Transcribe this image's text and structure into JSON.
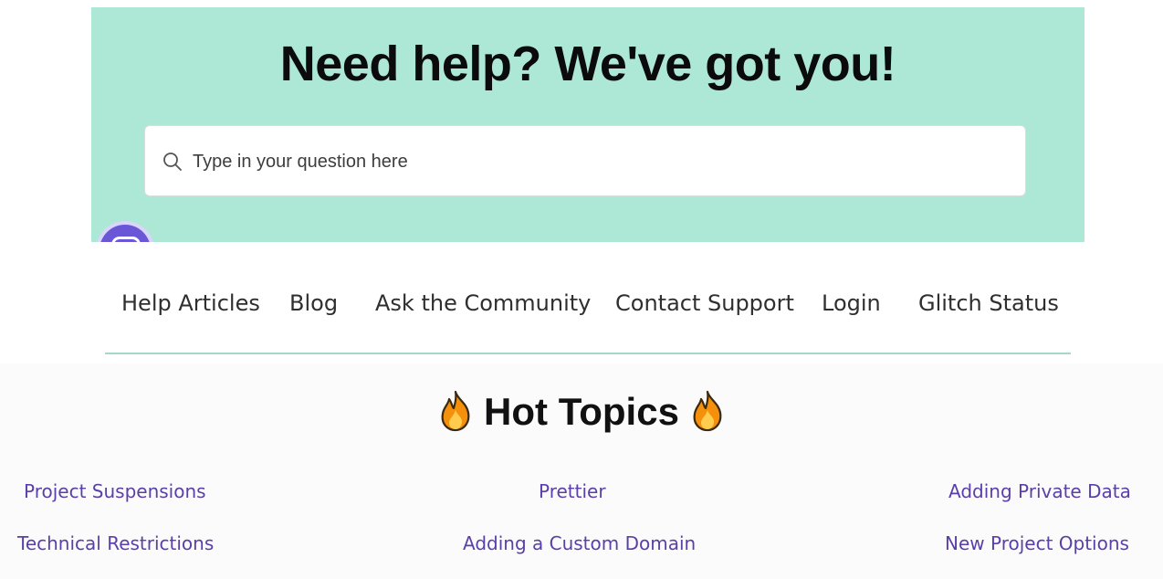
{
  "hero": {
    "title": "Need help? We've got you!",
    "background_color": "#ade8d6"
  },
  "search": {
    "placeholder": "Type in your question here",
    "value": "",
    "icon": "search-icon"
  },
  "chat_widget": {
    "icon": "chat-bubble-icon",
    "color": "#6a57d8"
  },
  "nav": {
    "items": [
      {
        "label": "Help Articles"
      },
      {
        "label": "Blog"
      },
      {
        "label": "Ask the Community"
      },
      {
        "label": "Contact Support"
      },
      {
        "label": "Login"
      },
      {
        "label": "Glitch Status"
      }
    ],
    "rule_color": "#a6d8c8"
  },
  "hot_topics": {
    "heading": "Hot Topics",
    "heading_icon": "fire-icon",
    "link_color": "#5b3fa8",
    "links": [
      {
        "label": "Project Suspensions"
      },
      {
        "label": "Prettier"
      },
      {
        "label": "Adding Private Data"
      },
      {
        "label": "Technical Restrictions"
      },
      {
        "label": "Adding a Custom Domain"
      },
      {
        "label": "New Project Options"
      }
    ]
  }
}
